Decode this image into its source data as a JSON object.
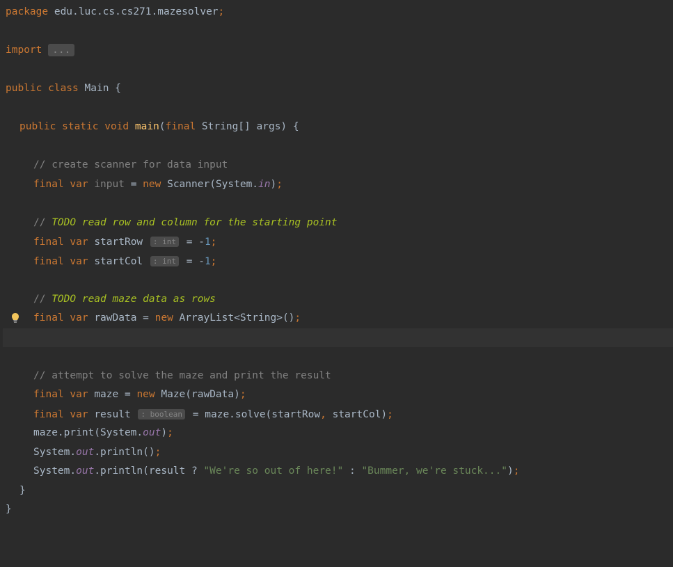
{
  "line1": {
    "kw": "package",
    "pkg": " edu.luc.cs.cs271.mazesolver",
    "semi": ";"
  },
  "line3": {
    "kw": "import ",
    "fold": "..."
  },
  "line5": {
    "kw1": "public ",
    "kw2": "class ",
    "name": "Main ",
    "brace": "{"
  },
  "line7": {
    "kw1": "public ",
    "kw2": "static ",
    "kw3": "void ",
    "method": "main",
    "p1": "(",
    "kw4": "final ",
    "type": "String[] ",
    "arg": "args",
    "p2": ") ",
    "brace": "{"
  },
  "line9": "// create scanner for data input",
  "line10": {
    "kw1": "final ",
    "kw2": "var ",
    "name": "input",
    "eq": " = ",
    "kw3": "new ",
    "ctor": "Scanner(System.",
    "field": "in",
    "close": ")",
    "semi": ";"
  },
  "line12": {
    "prefix": "// ",
    "todo": "TODO read row and column for the starting point"
  },
  "line13": {
    "kw1": "final ",
    "kw2": "var ",
    "name": "startRow",
    "hint": ": int",
    "eq": " = -",
    "num": "1",
    "semi": ";"
  },
  "line14": {
    "kw1": "final ",
    "kw2": "var ",
    "name": "startCol",
    "hint": ": int",
    "eq": " = -",
    "num": "1",
    "semi": ";"
  },
  "line16": {
    "prefix": "// ",
    "todo": "TODO read maze data as rows"
  },
  "line17": {
    "kw1": "final ",
    "kw2": "var ",
    "name": "rawData",
    "eq": " = ",
    "kw3": "new ",
    "ctor": "ArrayList<String>()",
    "semi": ";"
  },
  "line20": "// attempt to solve the maze and print the result",
  "line21": {
    "kw1": "final ",
    "kw2": "var ",
    "name": "maze",
    "eq": " = ",
    "kw3": "new ",
    "ctor": "Maze(rawData)",
    "semi": ";"
  },
  "line22": {
    "kw1": "final ",
    "kw2": "var ",
    "name": "result",
    "hint": ": boolean",
    "eq": " = ",
    "expr1": "maze.solve(startRow",
    "comma": ", ",
    "expr2": "startCol)",
    "semi": ";"
  },
  "line23": {
    "expr1": "maze.print(System.",
    "field": "out",
    "close": ")",
    "semi": ";"
  },
  "line24": {
    "expr1": "System.",
    "field": "out",
    "expr2": ".println()",
    "semi": ";"
  },
  "line25": {
    "expr1": "System.",
    "field": "out",
    "expr2": ".println(result ? ",
    "str1": "\"We're so out of here!\"",
    "col": " : ",
    "str2": "\"Bummer, we're stuck...\"",
    "close": ")",
    "semi": ";"
  },
  "line26": "}",
  "line27": "}",
  "icons": {
    "bulb": "lightbulb-icon"
  }
}
